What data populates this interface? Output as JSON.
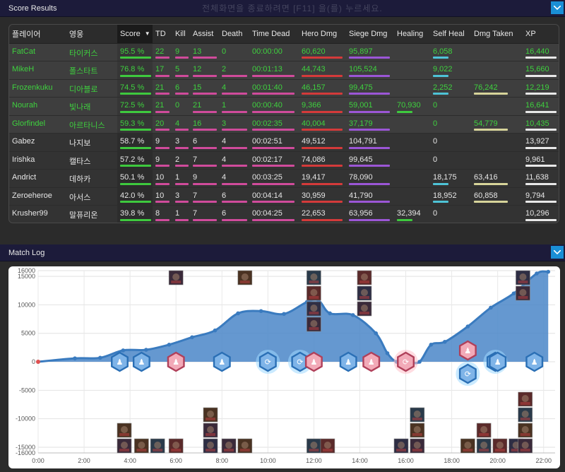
{
  "score_section": {
    "title": "Score Results",
    "ghost_text": "전체화면을 종료하려면 [F11] 을(를) 누르세요."
  },
  "log_section": {
    "title": "Match Log"
  },
  "colors": {
    "header_bg": "#1c1b3a",
    "accent": "#1a8fd6",
    "winner_text": "#3ed13e",
    "area_fill": "#4a86c8",
    "area_line": "#3a7bbf"
  },
  "icons": {
    "collapse": "chevron-down-icon"
  },
  "table": {
    "columns": [
      "플레이어",
      "영웅",
      "Score",
      "TD",
      "Kill",
      "Assist",
      "Death",
      "Time Dead",
      "Hero Dmg",
      "Siege Dmg",
      "Healing",
      "Self Heal",
      "Dmg Taken",
      "XP"
    ],
    "sort_column": "Score",
    "rows": [
      {
        "player": "FatCat",
        "hero": "타이커스",
        "score": "95.5 %",
        "td": "22",
        "kill": "9",
        "assist": "13",
        "death": "0",
        "time_dead": "00:00:00",
        "hero_dmg": "60,620",
        "siege_dmg": "95,897",
        "healing": "",
        "self_heal": "6,058",
        "dmg_taken": "",
        "xp": "16,440",
        "winner": true
      },
      {
        "player": "MikeH",
        "hero": "폴스타트",
        "score": "76.8 %",
        "td": "17",
        "kill": "5",
        "assist": "12",
        "death": "2",
        "time_dead": "00:01:13",
        "hero_dmg": "44,743",
        "siege_dmg": "105,524",
        "healing": "",
        "self_heal": "9,022",
        "dmg_taken": "",
        "xp": "15,660",
        "winner": true
      },
      {
        "player": "Frozenkuku",
        "hero": "디아블로",
        "score": "74.5 %",
        "td": "21",
        "kill": "6",
        "assist": "15",
        "death": "4",
        "time_dead": "00:01:40",
        "hero_dmg": "46,157",
        "siege_dmg": "99,475",
        "healing": "",
        "self_heal": "2,252",
        "dmg_taken": "76,242",
        "xp": "12,219",
        "winner": true
      },
      {
        "player": "Nourah",
        "hero": "빛나래",
        "score": "72.5 %",
        "td": "21",
        "kill": "0",
        "assist": "21",
        "death": "1",
        "time_dead": "00:00:40",
        "hero_dmg": "9,366",
        "siege_dmg": "59,001",
        "healing": "70,930",
        "self_heal": "0",
        "dmg_taken": "",
        "xp": "16,641",
        "winner": true
      },
      {
        "player": "Glorfindel",
        "hero": "아르타니스",
        "score": "59.3 %",
        "td": "20",
        "kill": "4",
        "assist": "16",
        "death": "3",
        "time_dead": "00:02:35",
        "hero_dmg": "40,004",
        "siege_dmg": "37,179",
        "healing": "",
        "self_heal": "0",
        "dmg_taken": "54,779",
        "xp": "10,435",
        "winner": true
      },
      {
        "player": "Gabez",
        "hero": "나지보",
        "score": "58.7 %",
        "td": "9",
        "kill": "3",
        "assist": "6",
        "death": "4",
        "time_dead": "00:02:51",
        "hero_dmg": "49,512",
        "siege_dmg": "104,791",
        "healing": "",
        "self_heal": "0",
        "dmg_taken": "",
        "xp": "13,927",
        "winner": false
      },
      {
        "player": "Irishka",
        "hero": "캘타스",
        "score": "57.2 %",
        "td": "9",
        "kill": "2",
        "assist": "7",
        "death": "4",
        "time_dead": "00:02:17",
        "hero_dmg": "74,086",
        "siege_dmg": "99,645",
        "healing": "",
        "self_heal": "0",
        "dmg_taken": "",
        "xp": "9,961",
        "winner": false
      },
      {
        "player": "Andrict",
        "hero": "데하카",
        "score": "50.1 %",
        "td": "10",
        "kill": "1",
        "assist": "9",
        "death": "4",
        "time_dead": "00:03:25",
        "hero_dmg": "19,417",
        "siege_dmg": "78,090",
        "healing": "",
        "self_heal": "18,175",
        "dmg_taken": "63,416",
        "xp": "11,638",
        "winner": false
      },
      {
        "player": "Zeroeheroe",
        "hero": "아서스",
        "score": "42.0 %",
        "td": "10",
        "kill": "3",
        "assist": "7",
        "death": "6",
        "time_dead": "00:04:14",
        "hero_dmg": "30,959",
        "siege_dmg": "41,790",
        "healing": "",
        "self_heal": "18,952",
        "dmg_taken": "60,858",
        "xp": "9,794",
        "winner": false
      },
      {
        "player": "Krusher99",
        "hero": "말퓨리온",
        "score": "39.8 %",
        "td": "8",
        "kill": "1",
        "assist": "7",
        "death": "6",
        "time_dead": "00:04:25",
        "hero_dmg": "22,653",
        "siege_dmg": "63,956",
        "healing": "32,394",
        "self_heal": "0",
        "dmg_taken": "",
        "xp": "10,296",
        "winner": false
      }
    ]
  },
  "chart_data": {
    "type": "area",
    "x_ticks": [
      "0:00",
      "2:00",
      "4:00",
      "6:00",
      "8:00",
      "10:00",
      "12:00",
      "14:00",
      "16:00",
      "18:00",
      "20:00",
      "22:00"
    ],
    "y_ticks": [
      "16000",
      "15000",
      "10000",
      "5000",
      "0",
      "-5000",
      "-10000",
      "-15000",
      "-16000"
    ],
    "ylim": [
      -16000,
      16000
    ],
    "xlim_minutes": [
      0,
      22.5
    ],
    "grid": true,
    "series": [
      {
        "x_minutes": [
          0,
          1.6,
          2.7,
          3.7,
          4.7,
          5.7,
          6.7,
          7.7,
          8.7,
          9.7,
          10.7,
          11.7,
          12.2,
          12.7,
          13.7,
          14.7,
          15.2,
          15.6,
          16.1,
          16.6,
          17.1,
          17.7,
          18.7,
          19.7,
          20.7,
          21.7,
          22.2
        ],
        "values": [
          0,
          600,
          700,
          2000,
          2100,
          3000,
          4300,
          5500,
          8500,
          8900,
          8400,
          10500,
          10800,
          8500,
          8200,
          5000,
          1500,
          0,
          -100,
          0,
          3000,
          3500,
          6200,
          9500,
          12000,
          15500,
          15800
        ]
      }
    ],
    "event_markers": [
      {
        "x_minutes": 3.55,
        "icon": "team-mercenary-icon",
        "team": "blue"
      },
      {
        "x_minutes": 4.5,
        "icon": "team-mercenary-icon",
        "team": "blue"
      },
      {
        "x_minutes": 6.0,
        "icon": "team-mercenary-icon",
        "team": "red"
      },
      {
        "x_minutes": 8.0,
        "icon": "team-mercenary-icon",
        "team": "blue"
      },
      {
        "x_minutes": 10.0,
        "icon": "objective-swirl-icon",
        "team": "blue"
      },
      {
        "x_minutes": 11.4,
        "icon": "objective-swirl-icon",
        "team": "blue"
      },
      {
        "x_minutes": 12.0,
        "icon": "team-mercenary-icon",
        "team": "red"
      },
      {
        "x_minutes": 13.5,
        "icon": "team-mercenary-icon",
        "team": "blue"
      },
      {
        "x_minutes": 14.5,
        "icon": "team-mercenary-icon",
        "team": "red"
      },
      {
        "x_minutes": 16.0,
        "icon": "objective-swirl-icon",
        "team": "red"
      },
      {
        "x_minutes": 18.7,
        "icon": "team-mercenary-icon",
        "team": "red",
        "above": true
      },
      {
        "x_minutes": 18.7,
        "icon": "objective-swirl-icon",
        "team": "blue",
        "below": true
      },
      {
        "x_minutes": 19.9,
        "icon": "objective-swirl-icon",
        "team": "blue"
      },
      {
        "x_minutes": 20.0,
        "icon": "team-mercenary-icon",
        "team": "blue"
      },
      {
        "x_minutes": 21.6,
        "icon": "team-mercenary-icon",
        "team": "blue"
      }
    ],
    "death_portraits_top": [
      {
        "x_minutes": 6.0,
        "count": 1
      },
      {
        "x_minutes": 9.0,
        "count": 1
      },
      {
        "x_minutes": 12.0,
        "count": 4
      },
      {
        "x_minutes": 14.2,
        "count": 3
      },
      {
        "x_minutes": 21.1,
        "count": 2
      }
    ],
    "death_portraits_bottom": [
      {
        "x_minutes": 3.75,
        "count": 2
      },
      {
        "x_minutes": 4.5,
        "count": 1
      },
      {
        "x_minutes": 5.2,
        "count": 1
      },
      {
        "x_minutes": 6.0,
        "count": 1
      },
      {
        "x_minutes": 7.5,
        "count": 3
      },
      {
        "x_minutes": 8.3,
        "count": 1
      },
      {
        "x_minutes": 9.0,
        "count": 1
      },
      {
        "x_minutes": 12.0,
        "count": 1
      },
      {
        "x_minutes": 12.6,
        "count": 1
      },
      {
        "x_minutes": 15.8,
        "count": 1
      },
      {
        "x_minutes": 16.5,
        "count": 3
      },
      {
        "x_minutes": 18.7,
        "count": 1
      },
      {
        "x_minutes": 19.4,
        "count": 2
      },
      {
        "x_minutes": 20.1,
        "count": 1
      },
      {
        "x_minutes": 20.8,
        "count": 1
      },
      {
        "x_minutes": 21.2,
        "count": 4
      }
    ]
  }
}
